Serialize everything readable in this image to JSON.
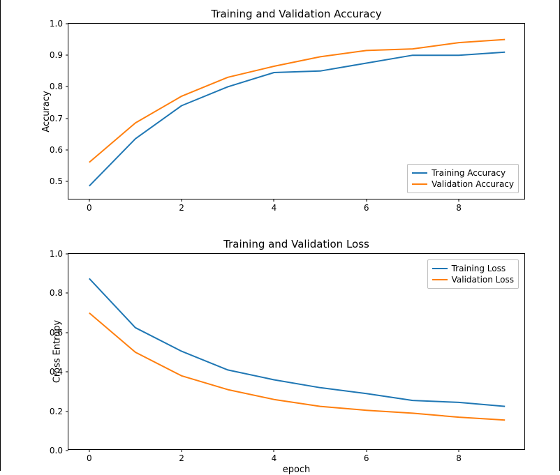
{
  "chart_data": [
    {
      "type": "line",
      "title": "Training and Validation Accuracy",
      "xlabel": "",
      "ylabel": "Accuracy",
      "ylim": [
        0.44,
        1.0
      ],
      "xlim": [
        -0.45,
        9.45
      ],
      "xticks": [
        0,
        2,
        4,
        6,
        8
      ],
      "yticks": [
        0.5,
        0.6,
        0.7,
        0.8,
        0.9,
        1.0
      ],
      "legend_position": "lower right",
      "x": [
        0,
        1,
        2,
        3,
        4,
        5,
        6,
        7,
        8,
        9
      ],
      "series": [
        {
          "name": "Training Accuracy",
          "color": "#1f77b4",
          "values": [
            0.485,
            0.635,
            0.74,
            0.8,
            0.845,
            0.85,
            0.875,
            0.9,
            0.9,
            0.91
          ]
        },
        {
          "name": "Validation Accuracy",
          "color": "#ff7f0e",
          "values": [
            0.56,
            0.685,
            0.77,
            0.83,
            0.865,
            0.895,
            0.915,
            0.92,
            0.94,
            0.95
          ]
        }
      ]
    },
    {
      "type": "line",
      "title": "Training and Validation Loss",
      "xlabel": "epoch",
      "ylabel": "Cross Entropy",
      "ylim": [
        0.0,
        1.0
      ],
      "xlim": [
        -0.45,
        9.45
      ],
      "xticks": [
        0,
        2,
        4,
        6,
        8
      ],
      "yticks": [
        0.0,
        0.2,
        0.4,
        0.6,
        0.8,
        1.0
      ],
      "legend_position": "upper right",
      "x": [
        0,
        1,
        2,
        3,
        4,
        5,
        6,
        7,
        8,
        9
      ],
      "series": [
        {
          "name": "Training Loss",
          "color": "#1f77b4",
          "values": [
            0.875,
            0.625,
            0.505,
            0.41,
            0.36,
            0.32,
            0.29,
            0.255,
            0.245,
            0.225
          ]
        },
        {
          "name": "Validation Loss",
          "color": "#ff7f0e",
          "values": [
            0.7,
            0.5,
            0.38,
            0.31,
            0.26,
            0.225,
            0.205,
            0.19,
            0.17,
            0.155
          ]
        }
      ]
    }
  ]
}
